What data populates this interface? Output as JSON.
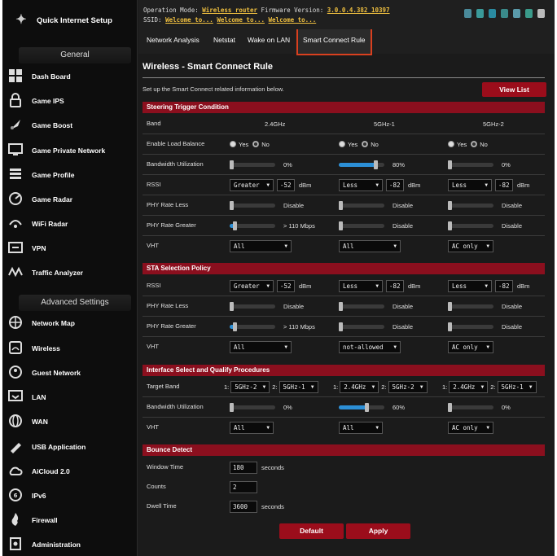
{
  "sidebar": {
    "quick_setup": "Quick Internet Setup",
    "general_header": "General",
    "advanced_header": "Advanced Settings",
    "general_items": [
      {
        "label": "Dash Board",
        "icon": "dashboard-icon"
      },
      {
        "label": "Game IPS",
        "icon": "lock-icon"
      },
      {
        "label": "Game Boost",
        "icon": "rocket-icon"
      },
      {
        "label": "Game Private Network",
        "icon": "monitor-icon"
      },
      {
        "label": "Game Profile",
        "icon": "profile-icon"
      },
      {
        "label": "Game Radar",
        "icon": "radar-icon"
      },
      {
        "label": "WiFi Radar",
        "icon": "wifi-radar-icon"
      },
      {
        "label": "VPN",
        "icon": "vpn-icon"
      },
      {
        "label": "Traffic Analyzer",
        "icon": "traffic-icon"
      }
    ],
    "advanced_items": [
      {
        "label": "Network Map",
        "icon": "network-map-icon"
      },
      {
        "label": "Wireless",
        "icon": "wireless-icon"
      },
      {
        "label": "Guest Network",
        "icon": "guest-icon"
      },
      {
        "label": "LAN",
        "icon": "lan-icon"
      },
      {
        "label": "WAN",
        "icon": "globe-icon"
      },
      {
        "label": "USB Application",
        "icon": "usb-icon"
      },
      {
        "label": "AiCloud 2.0",
        "icon": "cloud-icon"
      },
      {
        "label": "IPv6",
        "icon": "ipv6-icon"
      },
      {
        "label": "Firewall",
        "icon": "firewall-icon"
      },
      {
        "label": "Administration",
        "icon": "admin-icon"
      }
    ]
  },
  "header": {
    "op_mode_label": "Operation Mode:",
    "op_mode_value": "Wireless router",
    "fw_label": "Firmware Version:",
    "fw_value": "3.0.0.4.382_10397",
    "ssid_label": "SSID:",
    "ssid1": "Welcome to...",
    "ssid2": "Welcome to...",
    "ssid3": "Welcome to..."
  },
  "tabs": [
    "Network Analysis",
    "Netstat",
    "Wake on LAN",
    "Smart Connect Rule"
  ],
  "main": {
    "title": "Wireless - Smart Connect Rule",
    "description": "Set up the Smart Connect related information below.",
    "view_list": "View List"
  },
  "steering": {
    "section": "Steering Trigger Condition",
    "band_label": "Band",
    "bands": [
      "2.4GHz",
      "5GHz-1",
      "5GHz-2"
    ],
    "load_balance_label": "Enable Load Balance",
    "yes": "Yes",
    "no": "No",
    "bw_label": "Bandwidth Utilization",
    "bw": [
      {
        "value": "0%",
        "level": 0
      },
      {
        "value": "80%",
        "level": 0.8
      },
      {
        "value": "0%",
        "level": 0
      }
    ],
    "rssi_label": "RSSI",
    "rssi": [
      {
        "op": "Greater",
        "val": "-52"
      },
      {
        "op": "Less",
        "val": "-82"
      },
      {
        "op": "Less",
        "val": "-82"
      }
    ],
    "dbm": "dBm",
    "phy_less_label": "PHY Rate Less",
    "phy_less": [
      {
        "value": "Disable",
        "level": 0
      },
      {
        "value": "Disable",
        "level": 0
      },
      {
        "value": "Disable",
        "level": 0
      }
    ],
    "phy_greater_label": "PHY Rate Greater",
    "phy_greater": [
      {
        "value": "> 110 Mbps",
        "level": 0.1
      },
      {
        "value": "Disable",
        "level": 0
      },
      {
        "value": "Disable",
        "level": 0
      }
    ],
    "vht_label": "VHT",
    "vht": [
      "All",
      "All",
      "AC only"
    ]
  },
  "sta": {
    "section": "STA Selection Policy",
    "rssi_label": "RSSI",
    "rssi": [
      {
        "op": "Greater",
        "val": "-52"
      },
      {
        "op": "Less",
        "val": "-82"
      },
      {
        "op": "Less",
        "val": "-82"
      }
    ],
    "dbm": "dBm",
    "phy_less_label": "PHY Rate Less",
    "phy_less": [
      {
        "value": "Disable",
        "level": 0
      },
      {
        "value": "Disable",
        "level": 0
      },
      {
        "value": "Disable",
        "level": 0
      }
    ],
    "phy_greater_label": "PHY Rate Greater",
    "phy_greater": [
      {
        "value": "> 110 Mbps",
        "level": 0.1
      },
      {
        "value": "Disable",
        "level": 0
      },
      {
        "value": "Disable",
        "level": 0
      }
    ],
    "vht_label": "VHT",
    "vht": [
      "All",
      "not-allowed",
      "AC only"
    ]
  },
  "iface": {
    "section": "Interface Select and Qualify Procedures",
    "target_label": "Target Band",
    "targets": [
      {
        "n1": "1:",
        "b1": "5GHz-2",
        "n2": "2:",
        "b2": "5GHz-1"
      },
      {
        "n1": "1:",
        "b1": "2.4GHz",
        "n2": "2:",
        "b2": "5GHz-2"
      },
      {
        "n1": "1:",
        "b1": "2.4GHz",
        "n2": "2:",
        "b2": "5GHz-1"
      }
    ],
    "bw_label": "Bandwidth Utilization",
    "bw": [
      {
        "value": "0%",
        "level": 0
      },
      {
        "value": "60%",
        "level": 0.6
      },
      {
        "value": "0%",
        "level": 0
      }
    ],
    "vht_label": "VHT",
    "vht": [
      "All",
      "All",
      "AC only"
    ]
  },
  "bounce": {
    "section": "Bounce Detect",
    "window_label": "Window Time",
    "window_value": "180",
    "window_unit": "seconds",
    "counts_label": "Counts",
    "counts_value": "2",
    "dwell_label": "Dwell Time",
    "dwell_value": "3600",
    "dwell_unit": "seconds"
  },
  "buttons": {
    "default": "Default",
    "apply": "Apply"
  },
  "colors": {
    "accent": "#8b0f1e",
    "button": "#9b0d1b",
    "slider_fill": "#2c8fd6",
    "tab_highlight": "#d9401f"
  }
}
